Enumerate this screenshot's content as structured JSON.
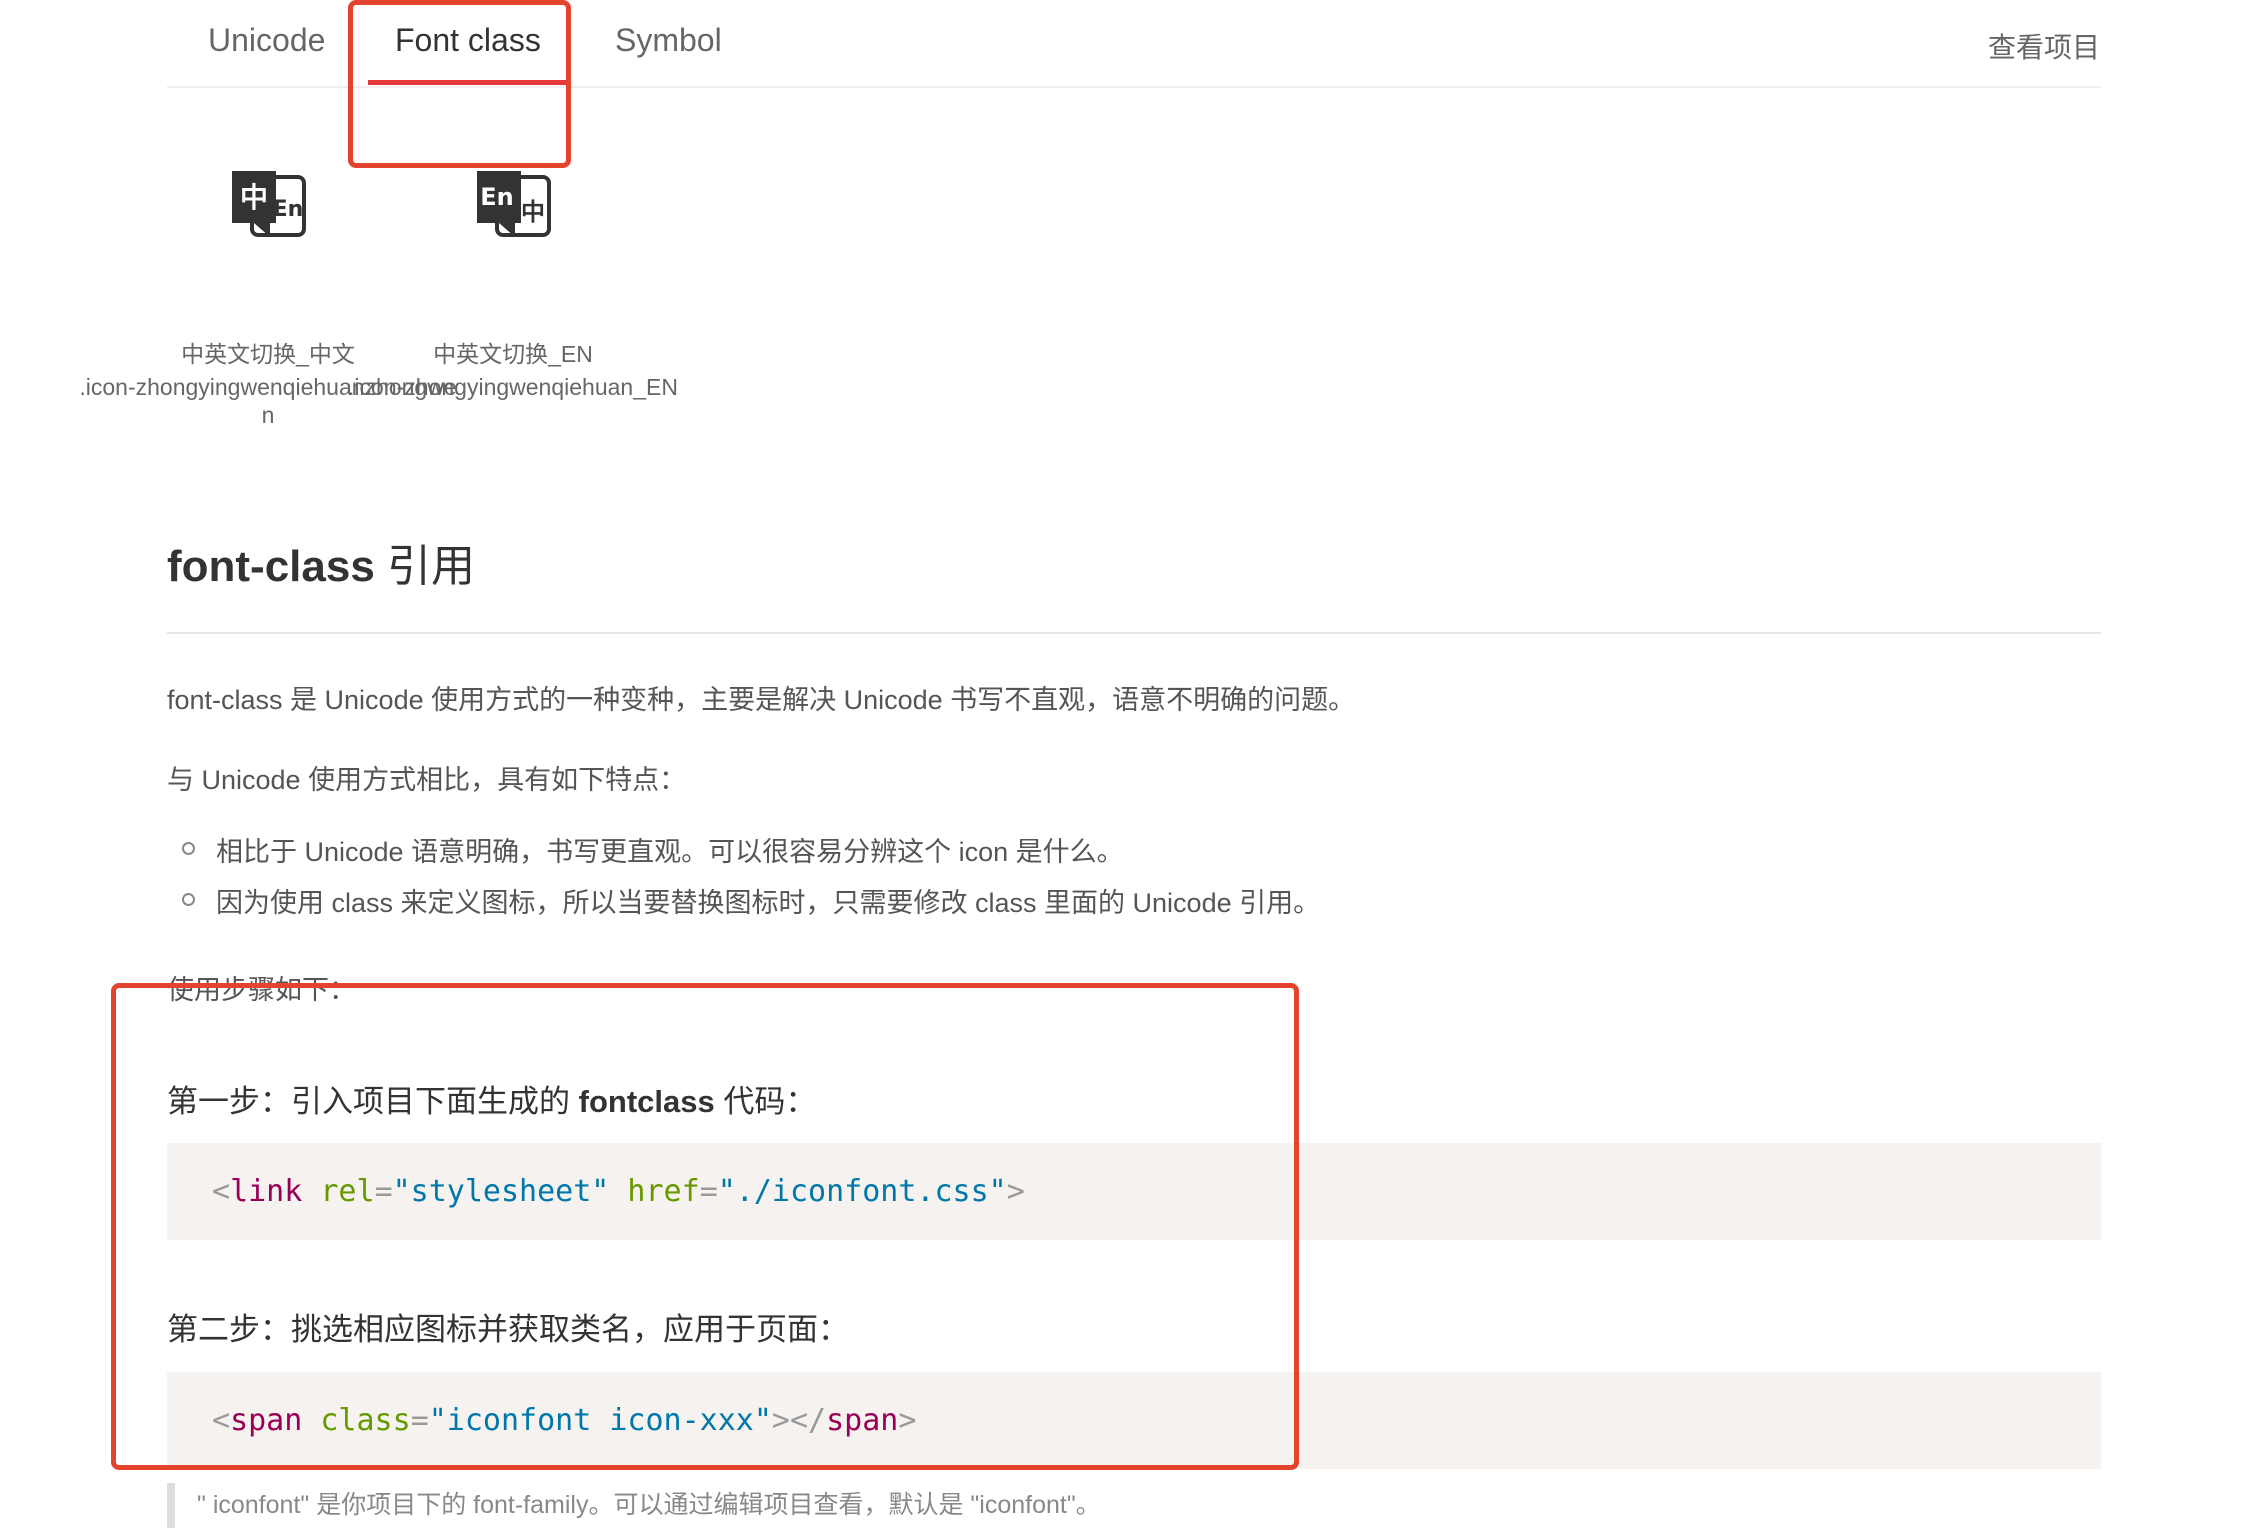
{
  "tabs": [
    {
      "label": "Unicode"
    },
    {
      "label": "Font class"
    },
    {
      "label": "Symbol"
    }
  ],
  "view_project": "查看项目",
  "icons": [
    {
      "name": "中英文切换_中文",
      "code": ".icon-zhongyingwenqiehuanzhongwen",
      "big": "中",
      "small": "En"
    },
    {
      "name": "中英文切换_EN",
      "code": ".icon-zhongyingwenqiehuan_EN",
      "big": "En",
      "small": "中"
    }
  ],
  "section": {
    "title_bold": "font-class",
    "title_rest": " 引用"
  },
  "paras": {
    "p1": "font-class 是 Unicode 使用方式的一种变种，主要是解决 Unicode 书写不直观，语意不明确的问题。",
    "p2": "与 Unicode 使用方式相比，具有如下特点：",
    "p3": "使用步骤如下："
  },
  "bullets": [
    "相比于 Unicode 语意明确，书写更直观。可以很容易分辨这个 icon 是什么。",
    "因为使用 class 来定义图标，所以当要替换图标时，只需要修改 class 里面的 Unicode 引用。"
  ],
  "step1": {
    "prefix": "第一步：引入项目下面生成的 ",
    "bold": "fontclass",
    "suffix": " 代码："
  },
  "step2": {
    "text": "第二步：挑选相应图标并获取类名，应用于页面："
  },
  "code1": {
    "lt": "<",
    "tag": "link",
    "attr1": " rel",
    "eq1": "=",
    "val1": "\"stylesheet\"",
    "attr2": " href",
    "eq2": "=",
    "val2": "\"./iconfont.css\"",
    "gt": ">"
  },
  "code2": {
    "lt": "<",
    "tag": "span",
    "attr1": " class",
    "eq1": "=",
    "val1": "\"iconfont icon-xxx\"",
    "gt1": "></",
    "tag2": "span",
    "gt2": ">"
  },
  "note": "\" iconfont\" 是你项目下的 font-family。可以通过编辑项目查看，默认是 \"iconfont\"。",
  "colors": {
    "accent": "#e4393c",
    "highlight": "#e4432d"
  }
}
